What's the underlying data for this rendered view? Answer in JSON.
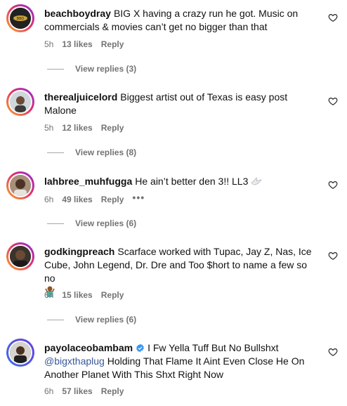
{
  "comments": [
    {
      "username": "beachboydray",
      "text": "BIG X having a crazy run he got. Music on commercials & movies can’t get no bigger than that",
      "time": "5h",
      "likes": "13 likes",
      "reply": "Reply",
      "view_replies": "View replies (3)"
    },
    {
      "username": "therealjuicelord",
      "text": "Biggest artist out of Texas is easy post Malone",
      "time": "5h",
      "likes": "12 likes",
      "reply": "Reply",
      "view_replies": "View replies (8)"
    },
    {
      "username": "lahbree_muhfugga",
      "text": "He ain’t better den 3!! LL3",
      "time": "6h",
      "likes": "49 likes",
      "reply": "Reply",
      "more": "•••",
      "view_replies": "View replies (6)"
    },
    {
      "username": "godkingpreach",
      "text": "Scarface worked with Tupac, Jay Z, Nas, Ice Cube, John Legend, Dr. Dre and Too $hort to name a few so no",
      "time": "6h",
      "likes": "15 likes",
      "reply": "Reply",
      "view_replies": "View replies (6)"
    },
    {
      "username": "payolaceobambam",
      "text_pre": "I Fw Yella Tuff But No Bullshxt",
      "mention": "@bigxthaplug",
      "text_post": "Holding That Flame It Aint Even Close He On Another Planet With This Shxt Right Now",
      "time": "6h",
      "likes": "57 likes",
      "reply": "Reply"
    }
  ],
  "icons": {
    "like": "heart-outline-icon",
    "verified": "verified-badge-icon",
    "dove": "dove-emoji",
    "shrug": "person-shrugging-emoji"
  },
  "colors": {
    "meta": "#737373",
    "mention": "#385898",
    "verified": "#3897f0"
  }
}
